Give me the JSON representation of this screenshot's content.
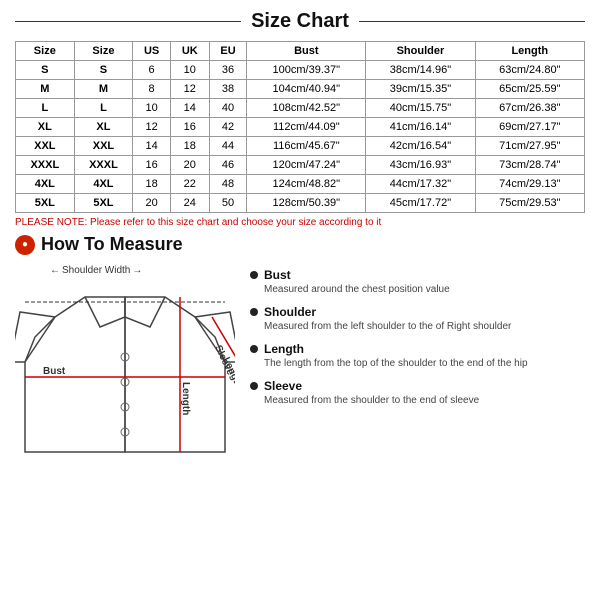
{
  "title": "Size Chart",
  "table": {
    "headers": [
      "Size",
      "Size",
      "US",
      "UK",
      "EU",
      "Bust",
      "Shoulder",
      "Length"
    ],
    "rows": [
      [
        "S",
        "S",
        "6",
        "10",
        "36",
        "100cm/39.37\"",
        "38cm/14.96\"",
        "63cm/24.80\""
      ],
      [
        "M",
        "M",
        "8",
        "12",
        "38",
        "104cm/40.94\"",
        "39cm/15.35\"",
        "65cm/25.59\""
      ],
      [
        "L",
        "L",
        "10",
        "14",
        "40",
        "108cm/42.52\"",
        "40cm/15.75\"",
        "67cm/26.38\""
      ],
      [
        "XL",
        "XL",
        "12",
        "16",
        "42",
        "112cm/44.09\"",
        "41cm/16.14\"",
        "69cm/27.17\""
      ],
      [
        "XXL",
        "XXL",
        "14",
        "18",
        "44",
        "116cm/45.67\"",
        "42cm/16.54\"",
        "71cm/27.95\""
      ],
      [
        "XXXL",
        "XXXL",
        "16",
        "20",
        "46",
        "120cm/47.24\"",
        "43cm/16.93\"",
        "73cm/28.74\""
      ],
      [
        "4XL",
        "4XL",
        "18",
        "22",
        "48",
        "124cm/48.82\"",
        "44cm/17.32\"",
        "74cm/29.13\""
      ],
      [
        "5XL",
        "5XL",
        "20",
        "24",
        "50",
        "128cm/50.39\"",
        "45cm/17.72\"",
        "75cm/29.53\""
      ]
    ]
  },
  "note": "PLEASE NOTE: Please refer to this size chart and choose your size according to it",
  "how_to_measure": {
    "title": "How To Measure",
    "circle_icon": "●",
    "labels": {
      "shoulder_width": "Shoulder Width",
      "bust": "Bust",
      "sleeve_length": "Sleeve\nLength",
      "length": "Length"
    },
    "items": [
      {
        "title": "Bust",
        "desc": "Measured around the chest position value"
      },
      {
        "title": "Shoulder",
        "desc": "Measured from the left shoulder to the of Right shoulder"
      },
      {
        "title": "Length",
        "desc": "The length from the top of the shoulder to the end of the hip"
      },
      {
        "title": "Sleeve",
        "desc": "Measured from the shoulder to the end of sleeve"
      }
    ]
  }
}
